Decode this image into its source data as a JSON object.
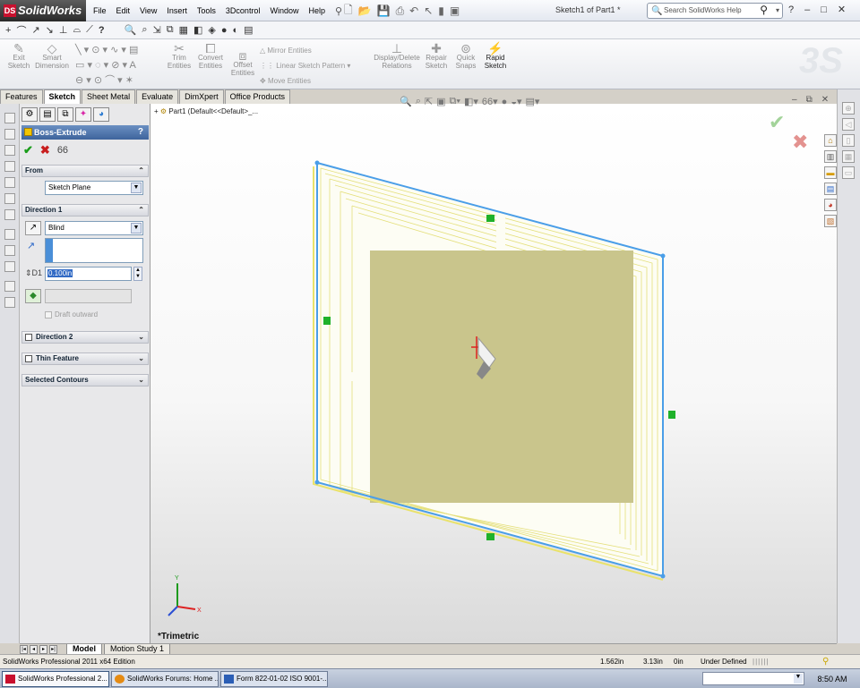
{
  "app": {
    "brand": "SolidWorks",
    "brand_badge": "DS",
    "document_title": "Sketch1 of Part1 *"
  },
  "menu": [
    "File",
    "Edit",
    "View",
    "Insert",
    "Tools",
    "3Dcontrol",
    "Window",
    "Help"
  ],
  "search": {
    "placeholder": "Search SolidWorks Help"
  },
  "window_controls": {
    "help": "?",
    "minimize": "–",
    "restore": "□",
    "close": "✕"
  },
  "command_manager": {
    "exit_sketch": "Exit Sketch",
    "smart_dimension": "Smart Dimension",
    "trim_entities": "Trim Entities",
    "convert_entities": "Convert Entities",
    "offset_entities": "Offset Entities",
    "mirror_entities": "Mirror Entities",
    "linear_sketch_pattern": "Linear Sketch Pattern",
    "move_entities": "Move Entities",
    "display_delete_relations": "Display/Delete Relations",
    "repair_sketch": "Repair Sketch",
    "quick_snaps": "Quick Snaps",
    "rapid_sketch": "Rapid Sketch"
  },
  "tabs": [
    "Features",
    "Sketch",
    "Sheet Metal",
    "Evaluate",
    "DimXpert",
    "Office Products"
  ],
  "active_tab": "Sketch",
  "property_manager": {
    "title": "Boss-Extrude",
    "help": "?",
    "from": {
      "label": "From",
      "value": "Sketch Plane"
    },
    "direction1": {
      "label": "Direction 1",
      "end_condition": "Blind",
      "depth": "0.100in",
      "draft_outward": "Draft outward"
    },
    "direction2": {
      "label": "Direction 2"
    },
    "thin_feature": {
      "label": "Thin Feature"
    },
    "selected_contours": {
      "label": "Selected Contours"
    }
  },
  "graphics": {
    "tree_label": "Part1  (Default<<Default>_...",
    "view_orientation": "*Trimetric"
  },
  "bottom_tabs": [
    "Model",
    "Motion Study 1"
  ],
  "status_bar": {
    "edition": "SolidWorks Professional 2011 x64 Edition",
    "x": "1.562in",
    "y": "3.13in",
    "z": "0in",
    "sketch_state": "Under Defined"
  },
  "taskbar": {
    "items": [
      "SolidWorks Professional 2...",
      "SolidWorks Forums: Home ...",
      "Form 822-01-02 ISO 9001-..."
    ],
    "clock": "8:50 AM"
  },
  "colors": {
    "sketch_blue": "#4a9ee8",
    "preview_fill": "#c8c48a",
    "sketch_yellow": "#e9e26a",
    "relation_green": "#1fb12a"
  }
}
